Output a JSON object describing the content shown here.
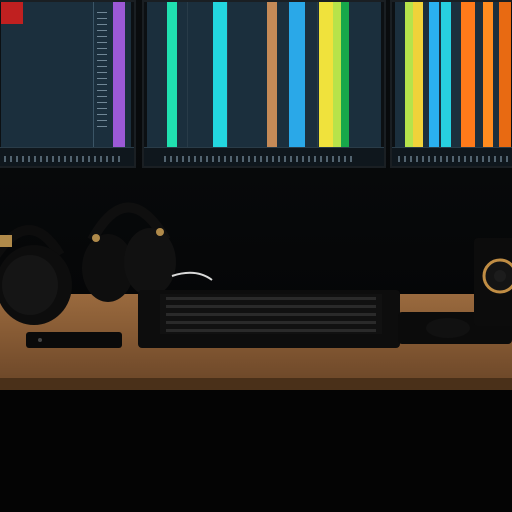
{
  "scene": {
    "monitors": [
      {
        "id": "left",
        "tracks": [
          "#2b4757",
          "#2b4757",
          "#2b4757",
          "#2b4757",
          "#9b59d6"
        ]
      },
      {
        "id": "center",
        "tracks": [
          "#20e0b0",
          "#16c8c0",
          "#23d6df",
          "#c58a57",
          "#2aa8e8",
          "#f0e23c",
          "#b8e34a",
          "#17a84a"
        ]
      },
      {
        "id": "right",
        "tracks": [
          "#b6e34b",
          "#f0d23a",
          "#2ab0f0",
          "#27d0e0",
          "#ff7a1a",
          "#ff8c1f",
          "#e86a12"
        ]
      }
    ],
    "colors": {
      "desk": "#8a5d35",
      "wall": "#07090b",
      "gear": "#0d0d0d"
    },
    "icons": [
      "headphones-icon",
      "headphones-icon",
      "keyboard-icon",
      "phone-icon",
      "mouse-icon",
      "speaker-icon"
    ]
  }
}
